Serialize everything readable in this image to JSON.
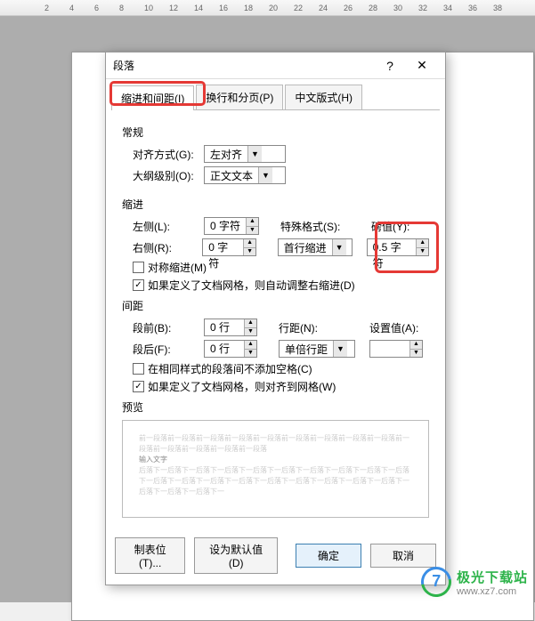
{
  "ruler": {
    "ticks": [
      "2",
      "4",
      "6",
      "8",
      "10",
      "12",
      "14",
      "16",
      "18",
      "20",
      "22",
      "24",
      "26",
      "28",
      "30",
      "32",
      "34",
      "36",
      "38"
    ]
  },
  "dialog": {
    "title": "段落",
    "help": "?",
    "close": "✕",
    "tabs": {
      "indent": "缩进和间距(I)",
      "page": "换行和分页(P)",
      "cn": "中文版式(H)"
    },
    "general": {
      "header": "常规",
      "align_label": "对齐方式(G):",
      "align_value": "左对齐",
      "outline_label": "大纲级别(O):",
      "outline_value": "正文文本"
    },
    "indent": {
      "header": "缩进",
      "left_label": "左侧(L):",
      "left_value": "0 字符",
      "right_label": "右侧(R):",
      "right_value": "0 字符",
      "special_label": "特殊格式(S):",
      "special_value": "首行缩进",
      "by_label": "磅值(Y):",
      "by_value": "0.5 字符",
      "sym": "对称缩进(M)",
      "auto": "如果定义了文档网格，则自动调整右缩进(D)"
    },
    "spacing": {
      "header": "间距",
      "before_label": "段前(B):",
      "before_value": "0 行",
      "after_label": "段后(F):",
      "after_value": "0 行",
      "line_label": "行距(N):",
      "line_value": "单倍行距",
      "at_label": "设置值(A):",
      "at_value": "",
      "nospace": "在相同样式的段落间不添加空格(C)",
      "snap": "如果定义了文档网格，则对齐到网格(W)"
    },
    "preview": {
      "header": "预览",
      "sample": "输入文字"
    },
    "buttons": {
      "tabs": "制表位(T)...",
      "default": "设为默认值(D)",
      "ok": "确定",
      "cancel": "取消"
    }
  },
  "watermark": {
    "name": "极光下载站",
    "url": "www.xz7.com"
  }
}
